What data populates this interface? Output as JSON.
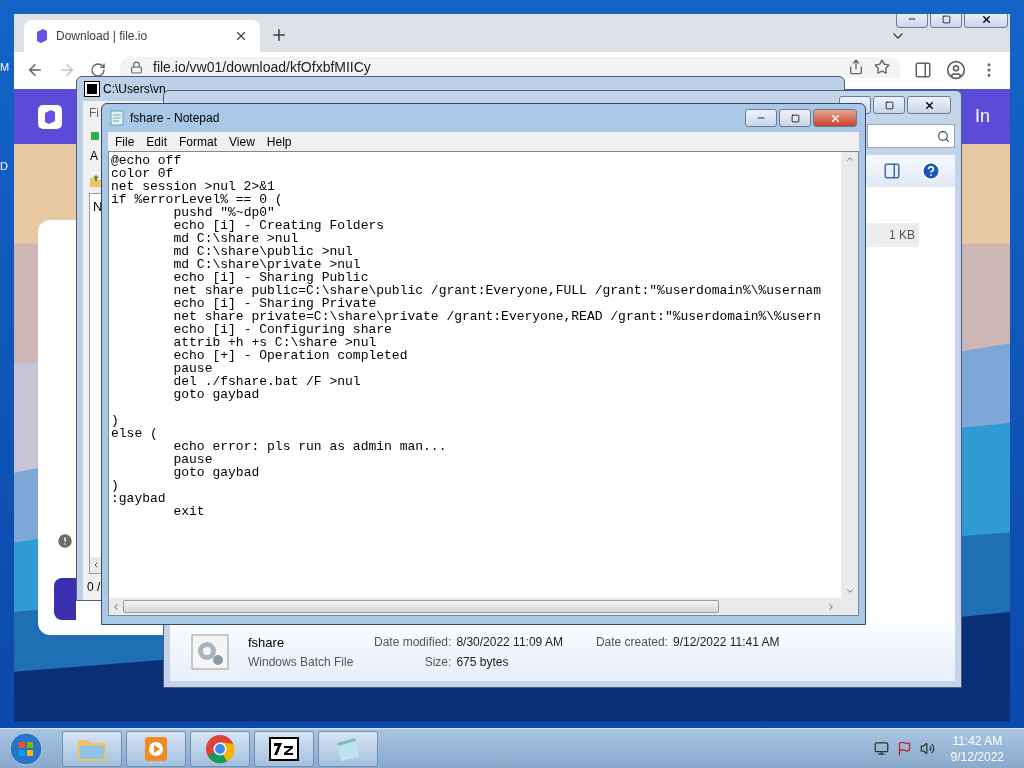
{
  "desktop": {
    "icon_labels": [
      "M",
      "D"
    ]
  },
  "browser": {
    "tab": {
      "title": "Download | file.io",
      "selected": true
    },
    "url": "file.io/vw01/download/kfOfxbfMIICy",
    "header_text": "In"
  },
  "archive_window": {
    "title": "C:\\Users\\vn",
    "menu": "Fi",
    "label": "A",
    "column": "N",
    "status": "0 /"
  },
  "explorer": {
    "file_size": "1 KB",
    "details": {
      "name": "fshare",
      "type": "Windows Batch File",
      "rows": [
        [
          {
            "label": "Date modified:",
            "value": "8/30/2022 11:09 AM"
          },
          {
            "label": "Date created:",
            "value": "9/12/2022 11:41 AM"
          }
        ],
        [
          {
            "label": "Size:",
            "value": "675 bytes"
          }
        ]
      ]
    }
  },
  "notepad": {
    "title": "fshare - Notepad",
    "active": true,
    "menu": [
      "File",
      "Edit",
      "Format",
      "View",
      "Help"
    ],
    "text": "@echo off\ncolor 0f\nnet session >nul 2>&1\nif %errorLevel% == 0 (\n\tpushd \"%~dp0\"\n\techo [i] - Creating Folders\n\tmd C:\\share >nul\n\tmd C:\\share\\public >nul\n\tmd C:\\share\\private >nul\n\techo [i] - Sharing Public\n\tnet share public=C:\\share\\public /grant:Everyone,FULL /grant:\"%userdomain%\\%usernam\n\techo [i] - Sharing Private\n\tnet share private=C:\\share\\private /grant:Everyone,READ /grant:\"%userdomain%\\%usern\n\techo [i] - Configuring share\n\tattrib +h +s C:\\share >nul\n\techo [+] - Operation completed\n\tpause\n\tdel ./fshare.bat /F >nul\n\tgoto gaybad\n\n)\nelse (\n\techo error: pls run as admin man...\n\tpause\n\tgoto gaybad\n)\n:gaybad\n\texit"
  },
  "taskbar": {
    "apps": [
      {
        "kind": "folder"
      },
      {
        "kind": "media"
      },
      {
        "kind": "browser"
      },
      {
        "kind": "archiver"
      },
      {
        "kind": "notepad"
      }
    ],
    "time": "11:42 AM",
    "date": "9/12/2022"
  }
}
